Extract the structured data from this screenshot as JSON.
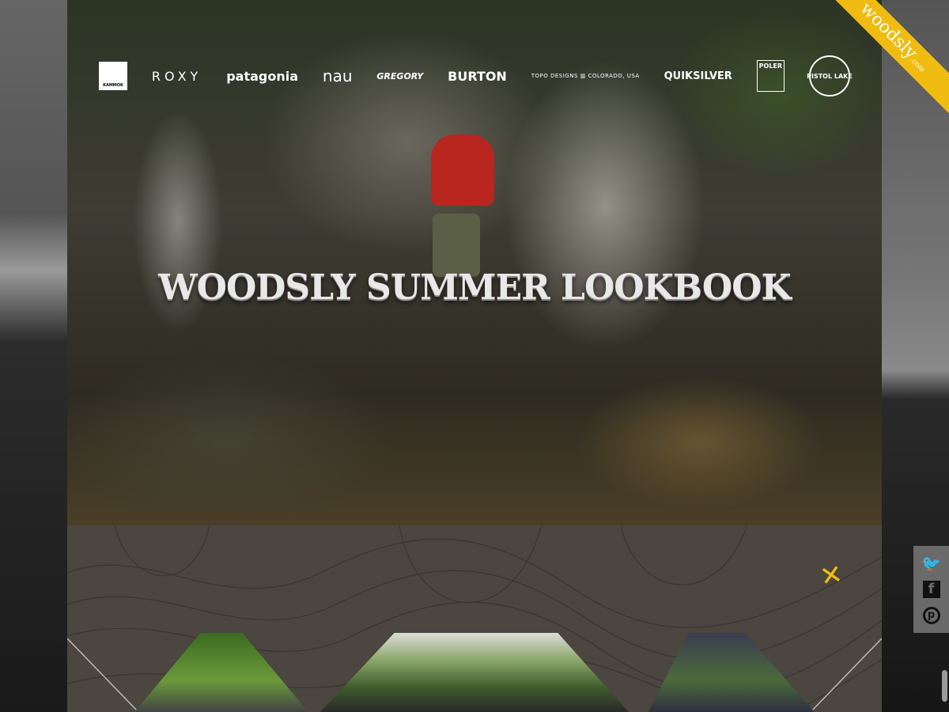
{
  "brand": {
    "ribbon_text": "woodsly",
    "ribbon_suffix": ".com",
    "accent": "#f0bc12"
  },
  "hero": {
    "title": "WOODSLY SUMMER LOOKBOOK"
  },
  "logos": [
    {
      "name": "kammok",
      "text": "KAMMOK"
    },
    {
      "name": "roxy",
      "text": "ROXY"
    },
    {
      "name": "patagonia",
      "text": "patagonia"
    },
    {
      "name": "nau",
      "text": "nau"
    },
    {
      "name": "gregory",
      "text": "GREGORY"
    },
    {
      "name": "burton",
      "text": "BURTON"
    },
    {
      "name": "topo-designs",
      "text": "TOPO DESIGNS ▥ COLORADO, USA"
    },
    {
      "name": "quiksilver",
      "text": "QUIKSILVER"
    },
    {
      "name": "poler",
      "text": "POLER"
    },
    {
      "name": "pistol-lake",
      "text": "PISTOL LAKE"
    }
  ],
  "social": {
    "icons": [
      "twitter-icon",
      "facebook-icon",
      "pinterest-icon"
    ],
    "twitter": "🐦",
    "facebook": "f",
    "pinterest": "p"
  },
  "close_glyph": "✕"
}
